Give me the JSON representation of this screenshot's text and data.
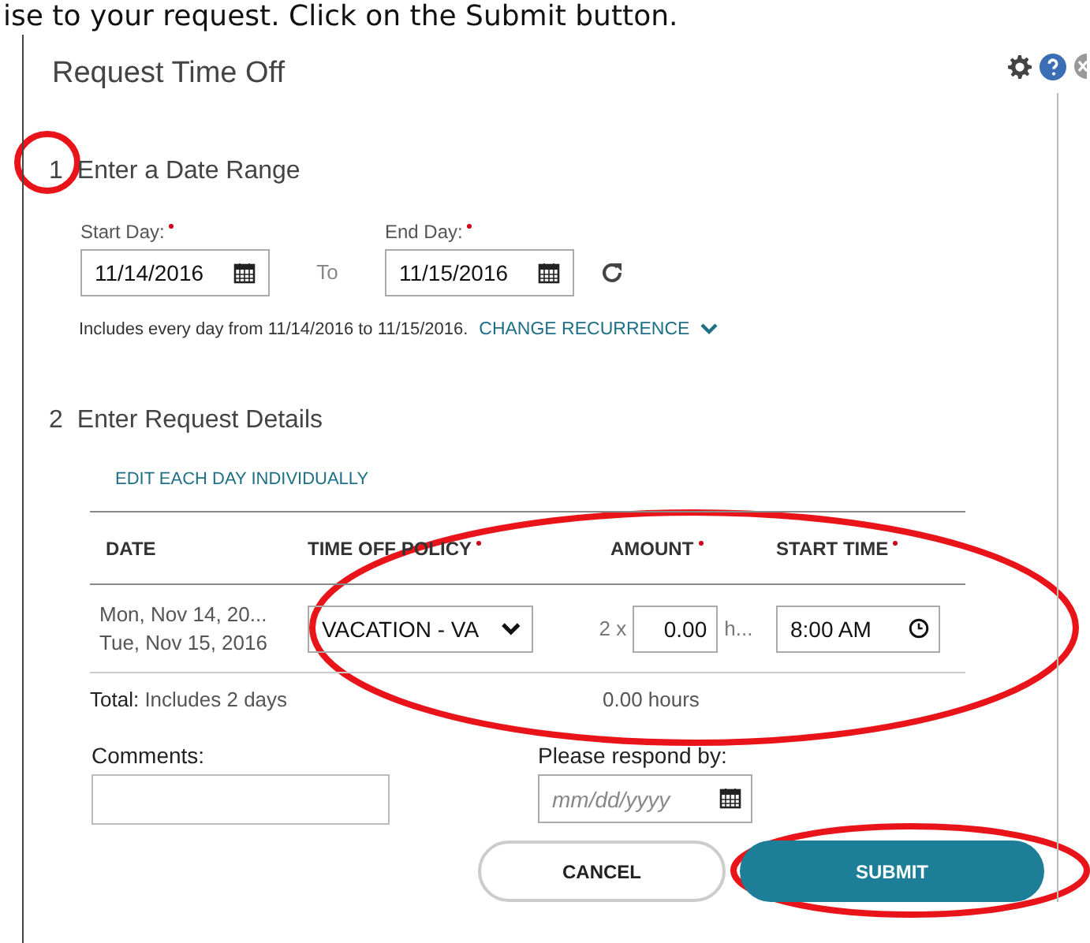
{
  "instruction": "ise to your request. Click on the Submit button.",
  "dialog": {
    "title": "Request Time Off"
  },
  "step1": {
    "number": "1",
    "title": "Enter a Date Range",
    "start": {
      "label": "Start Day:",
      "required": true,
      "value": "11/14/2016"
    },
    "to": "To",
    "end": {
      "label": "End Day:",
      "required": true,
      "value": "11/15/2016"
    },
    "summary": "Includes every day from 11/14/2016 to 11/15/2016.",
    "recurrence_link": "CHANGE RECURRENCE"
  },
  "step2": {
    "number": "2",
    "title": "Enter Request Details",
    "edit_link": "EDIT EACH DAY INDIVIDUALLY",
    "columns": [
      {
        "label": "DATE",
        "required": false
      },
      {
        "label": "TIME OFF POLICY",
        "required": true
      },
      {
        "label": "AMOUNT",
        "required": true
      },
      {
        "label": "START TIME",
        "required": true
      }
    ],
    "row": {
      "dates": [
        "Mon, Nov 14, 20...",
        "Tue, Nov 15, 2016"
      ],
      "policy": "VACATION - VA",
      "multiplier": "2 x",
      "amount": "0.00",
      "unit": "h...",
      "start_time": "8:00 AM"
    },
    "total": {
      "label": "Total:",
      "text": "Includes 2 days",
      "hours": "0.00 hours"
    },
    "comments": {
      "label": "Comments:"
    },
    "respond_by": {
      "label": "Please respond by:",
      "placeholder": "mm/dd/yyyy"
    }
  },
  "buttons": [
    {
      "label": "CANCEL",
      "kind": "secondary"
    },
    {
      "label": "SUBMIT",
      "kind": "primary"
    }
  ]
}
